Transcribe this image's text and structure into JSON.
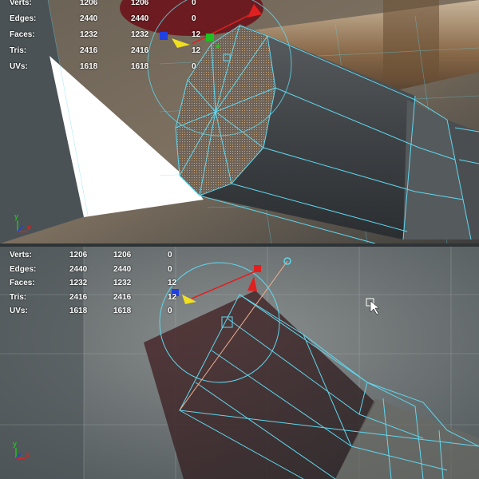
{
  "colors": {
    "wireframe": "#5fd8f0",
    "hud_text": "#ffffff",
    "axis_x": "#e02020",
    "axis_y": "#20c020",
    "axis_z": "#2040e0",
    "manip_center": "#f0e020"
  },
  "viewports": {
    "top": {
      "stats": [
        {
          "label": "Verts:",
          "v1": "1206",
          "v2": "1206",
          "v3": "0"
        },
        {
          "label": "Edges:",
          "v1": "2440",
          "v2": "2440",
          "v3": "0"
        },
        {
          "label": "Faces:",
          "v1": "1232",
          "v2": "1232",
          "v3": "12"
        },
        {
          "label": "Tris:",
          "v1": "2416",
          "v2": "2416",
          "v3": "12"
        },
        {
          "label": "UVs:",
          "v1": "1618",
          "v2": "1618",
          "v3": "0"
        }
      ],
      "axis_x": "x",
      "axis_y": "y"
    },
    "bottom": {
      "stats": [
        {
          "label": "Verts:",
          "v1": "1206",
          "v2": "1206",
          "v3": "0"
        },
        {
          "label": "Edges:",
          "v1": "2440",
          "v2": "2440",
          "v3": "0"
        },
        {
          "label": "Faces:",
          "v1": "1232",
          "v2": "1232",
          "v3": "12"
        },
        {
          "label": "Tris:",
          "v1": "2416",
          "v2": "2416",
          "v3": "12"
        },
        {
          "label": "UVs:",
          "v1": "1618",
          "v2": "1618",
          "v3": "0"
        }
      ],
      "axis_x": "x",
      "axis_y": "y"
    }
  },
  "icons": {
    "manipulator": "rotate-manipulator-icon",
    "cursor": "select-cursor-icon",
    "axis_indicator": "view-axis-icon"
  }
}
